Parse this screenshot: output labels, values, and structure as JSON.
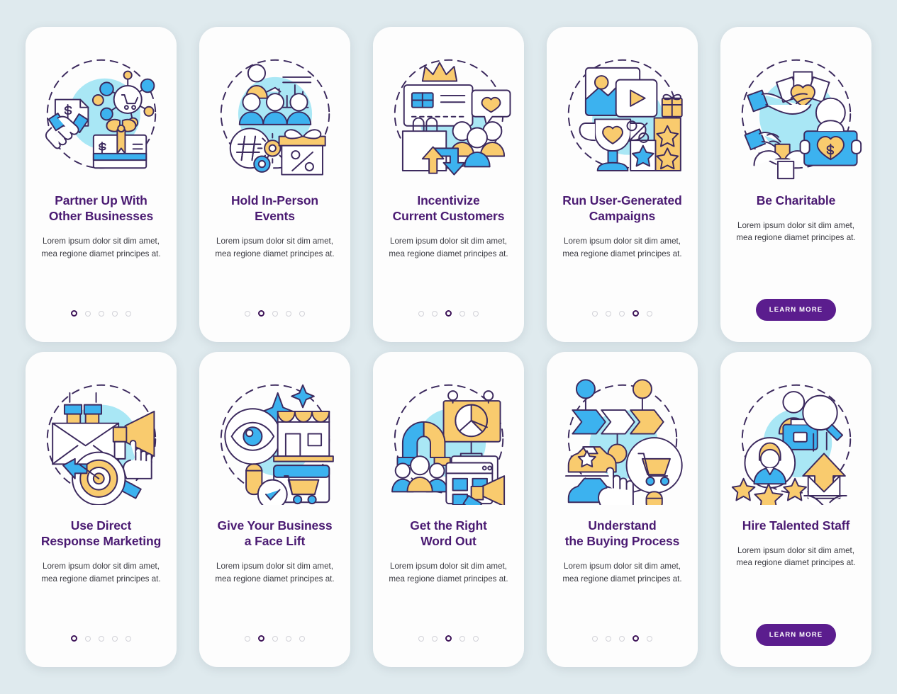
{
  "background_color": "#dfeaee",
  "palette": {
    "title": "#4a1a72",
    "body": "#3b3b42",
    "button_bg": "#5b1d8e",
    "button_text": "#ffffff",
    "dot_active": "#3d1358",
    "dot_inactive": "#d2d2d8",
    "illo_blue": "#3cb2ef",
    "illo_yellow": "#f9cb6e",
    "illo_teal": "#a9e7f5",
    "illo_outline": "#3c2a5e",
    "card_bg": "#fdfdfd"
  },
  "shared": {
    "description": "Lorem ipsum dolor sit dim amet, mea regione diamet principes at.",
    "learn_more_label": "LEARN MORE",
    "dot_count": 5
  },
  "cards": [
    {
      "id": "partner-up",
      "title": "Partner Up With Other Businesses",
      "title_lines": [
        "Partner Up With",
        "Other Businesses"
      ],
      "description": "Lorem ipsum dolor sit dim amet, mea regione diamet principes at.",
      "active_dot": 1,
      "has_button": false,
      "illustration": "handshake-network-giftcard"
    },
    {
      "id": "in-person-events",
      "title": "Hold In-Person Events",
      "title_lines": [
        "Hold In-Person",
        "Events"
      ],
      "description": "Lorem ipsum dolor sit dim amet, mea regione diamet principes at.",
      "active_dot": 2,
      "has_button": false,
      "illustration": "presenter-audience-hashtag-gift"
    },
    {
      "id": "incentivize-customers",
      "title": "Incentivize Current Customers",
      "title_lines": [
        "Incentivize",
        "Current Customers"
      ],
      "description": "Lorem ipsum dolor sit dim amet, mea regione diamet principes at.",
      "active_dot": 3,
      "has_button": false,
      "illustration": "crown-loyaltycard-people"
    },
    {
      "id": "user-generated-campaigns",
      "title": "Run User-Generated Campaigns",
      "title_lines": [
        "Run User-Generated",
        "Campaigns"
      ],
      "description": "Lorem ipsum dolor sit dim amet, mea regione diamet principes at.",
      "active_dot": 4,
      "has_button": false,
      "illustration": "media-trophy-stars"
    },
    {
      "id": "be-charitable",
      "title": "Be Charitable",
      "title_lines": [
        "Be Charitable"
      ],
      "description": "Lorem ipsum dolor sit dim amet, mea regione diamet principes at.",
      "active_dot": 0,
      "has_button": true,
      "button_label": "LEARN MORE",
      "illustration": "giving-hands-donation-box"
    },
    {
      "id": "direct-response-marketing",
      "title": "Use Direct Response Marketing",
      "title_lines": [
        "Use Direct",
        "Response Marketing"
      ],
      "description": "Lorem ipsum dolor sit dim amet, mea regione diamet principes at.",
      "active_dot": 1,
      "has_button": false,
      "illustration": "magnet-envelope-megaphone-target"
    },
    {
      "id": "business-face-lift",
      "title": "Give Your Business a Face Lift",
      "title_lines": [
        "Give Your Business",
        "a Face Lift"
      ],
      "description": "Lorem ipsum dolor sit dim amet, mea regione diamet principes at.",
      "active_dot": 2,
      "has_button": false,
      "illustration": "eye-magnifier-storefront-browser"
    },
    {
      "id": "get-word-out",
      "title": "Get the Right Word Out",
      "title_lines": [
        "Get the Right",
        "Word Out"
      ],
      "description": "Lorem ipsum dolor sit dim amet, mea regione diamet principes at.",
      "active_dot": 3,
      "has_button": false,
      "illustration": "billboard-people-browser-megaphone"
    },
    {
      "id": "understand-buying-process",
      "title": "Understand the Buying Process",
      "title_lines": [
        "Understand",
        "the Buying Process"
      ],
      "description": "Lorem ipsum dolor sit dim amet, mea regione diamet principes at.",
      "active_dot": 4,
      "has_button": false,
      "illustration": "process-arrows-cars-cart-magnifier"
    },
    {
      "id": "hire-talented-staff",
      "title": "Hire Talented Staff",
      "title_lines": [
        "Hire Talented Staff"
      ],
      "description": "Lorem ipsum dolor sit dim amet, mea regione diamet principes at.",
      "active_dot": 0,
      "has_button": true,
      "button_label": "LEARN MORE",
      "illustration": "candidate-stars-briefcase-handshake"
    }
  ]
}
